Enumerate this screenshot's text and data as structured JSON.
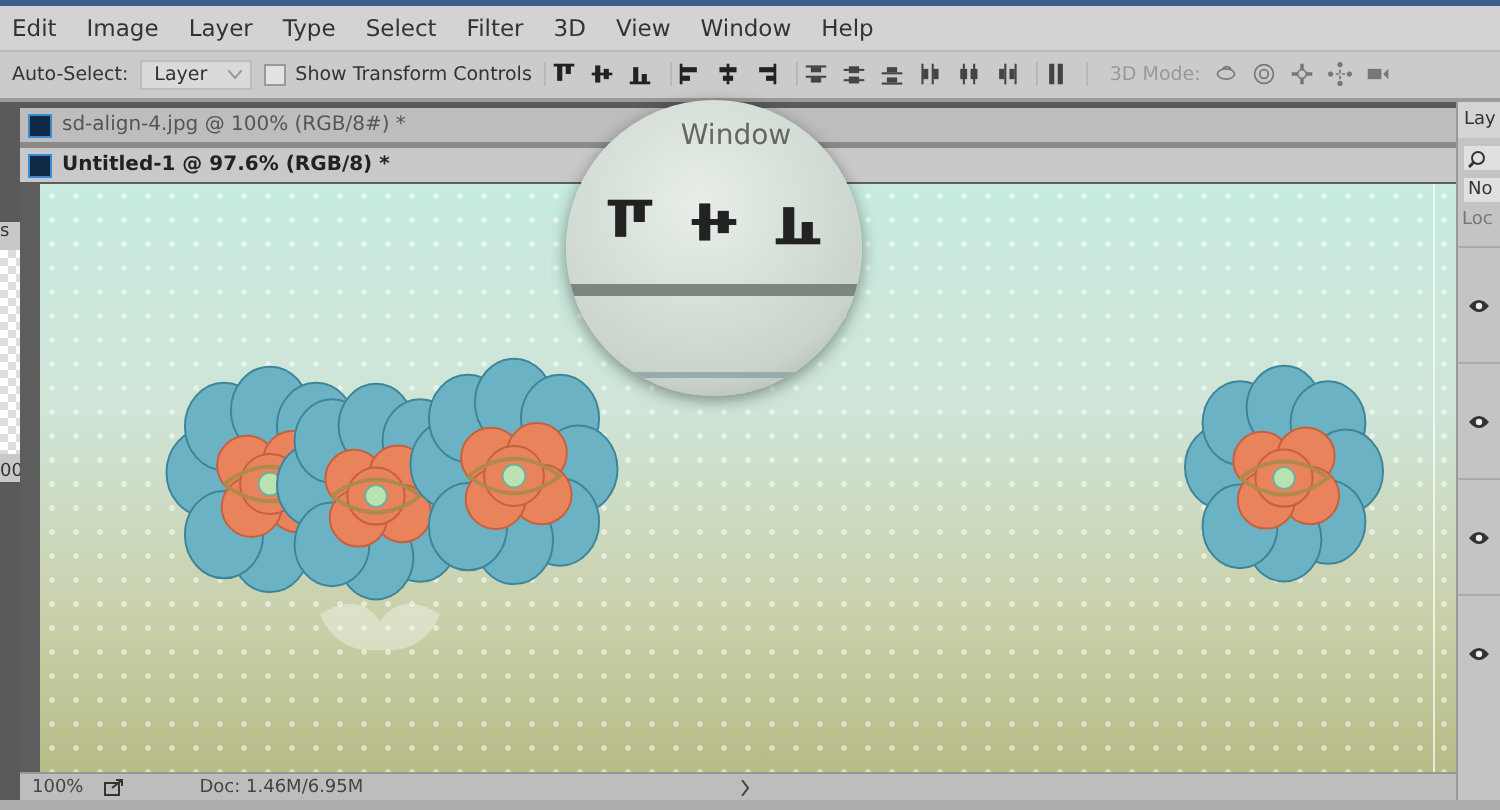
{
  "menu_bar": {
    "items": [
      "Edit",
      "Image",
      "Layer",
      "Type",
      "Select",
      "Filter",
      "3D",
      "View",
      "Window",
      "Help"
    ]
  },
  "options_bar": {
    "auto_select_label": "Auto-Select:",
    "auto_select_value": "Layer",
    "show_transform_controls": {
      "label": "Show Transform Controls",
      "checked": false
    },
    "mode_label": "3D Mode:"
  },
  "left_panel": {
    "texts": [
      "s",
      "00"
    ]
  },
  "document_tabs": [
    {
      "title": "sd-align-4.jpg @ 100% (RGB/8#) *",
      "selected": false
    },
    {
      "title": "Untitled-1 @ 97.6% (RGB/8) *",
      "selected": true
    }
  ],
  "magnifier": {
    "label": "Window"
  },
  "status_bar": {
    "zoom": "100%",
    "doc_size": "Doc: 1.46M/6.95M"
  },
  "layers_panel": {
    "tab": "Lay",
    "filter": "No",
    "lock": "Loc",
    "rows": [
      {
        "visible": true
      },
      {
        "visible": true
      },
      {
        "visible": true
      },
      {
        "visible": true
      }
    ]
  }
}
